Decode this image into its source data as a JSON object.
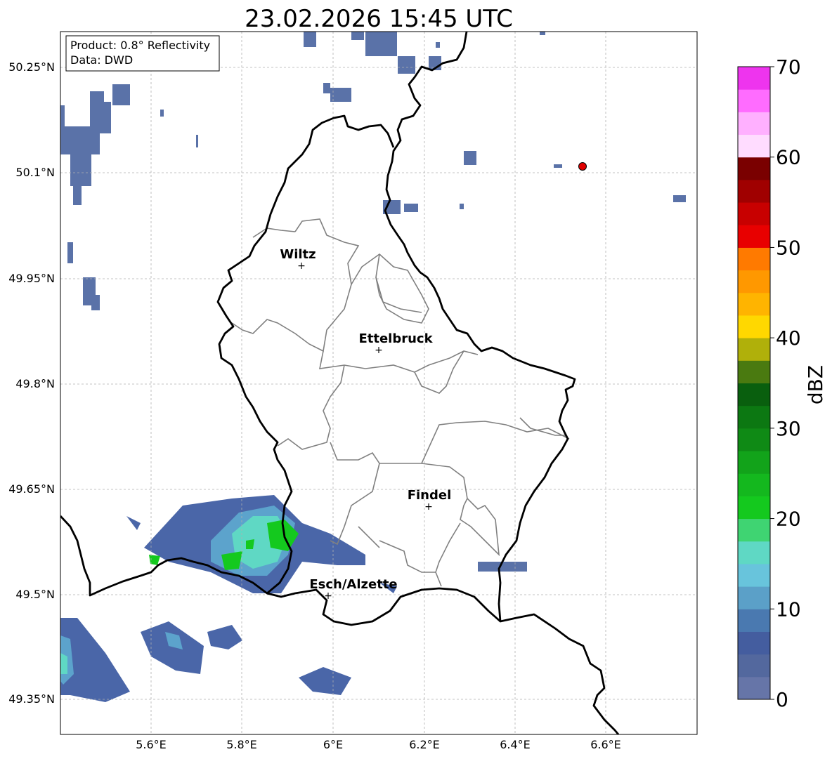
{
  "title": "23.02.2026 15:45 UTC",
  "info": {
    "product": "Product: 0.8° Reflectivity",
    "data": "Data: DWD"
  },
  "lat_labels": [
    "50.25°N",
    "50.1°N",
    "49.95°N",
    "49.8°N",
    "49.65°N",
    "49.5°N",
    "49.35°N"
  ],
  "lon_labels": [
    "5.6°E",
    "5.8°E",
    "6°E",
    "6.2°E",
    "6.4°E",
    "6.6°E"
  ],
  "cities": [
    {
      "name": "Wiltz"
    },
    {
      "name": "Ettelbruck"
    },
    {
      "name": "Findel"
    },
    {
      "name": "Esch/Alzette"
    }
  ],
  "colorbar": {
    "label": "dBZ",
    "ticks": [
      "0",
      "10",
      "20",
      "30",
      "40",
      "50",
      "60",
      "70"
    ],
    "colors": [
      "#6675a8",
      "#53689e",
      "#445d9f",
      "#4a79b0",
      "#5ba0c8",
      "#68c4dc",
      "#5fd8c4",
      "#3fd472",
      "#14c91e",
      "#14b81e",
      "#12a31a",
      "#0f8a15",
      "#0c7812",
      "#095f0e",
      "#4a7a10",
      "#b0b00a",
      "#ffd800",
      "#ffb400",
      "#ff9800",
      "#ff7a00",
      "#e80000",
      "#c80000",
      "#a00000",
      "#7a0000",
      "#ffdcff",
      "#ffb0ff",
      "#ff6cff",
      "#ee34ee"
    ]
  },
  "colors": {
    "border": "#000000",
    "canton": "#808080",
    "grid": "#b0b0b0",
    "marker": "#e00000"
  }
}
